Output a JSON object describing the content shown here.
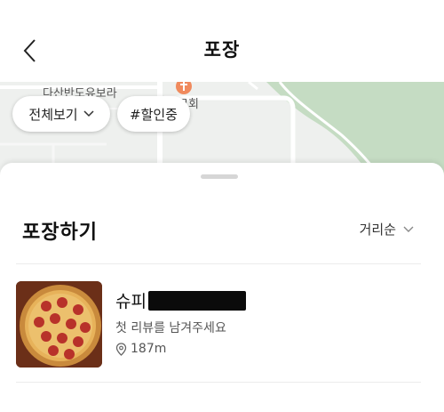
{
  "header": {
    "title": "포장",
    "back_icon": "chevron-left-icon"
  },
  "map": {
    "labels": [
      "다산반도유보라",
      "교회"
    ],
    "poi_icon": "church-marker-icon"
  },
  "filters": {
    "view_all": "전체보기",
    "discount": "#할인중"
  },
  "section": {
    "title": "포장하기",
    "sort_label": "거리순"
  },
  "stores": [
    {
      "name": "슈피",
      "review_prompt": "첫 리뷰를 남겨주세요",
      "distance": "187m"
    }
  ],
  "colors": {
    "map_bg": "#eef0ee",
    "map_green": "#c5dcc3",
    "map_road": "#ffffff",
    "poi_orange": "#f08a5d"
  }
}
